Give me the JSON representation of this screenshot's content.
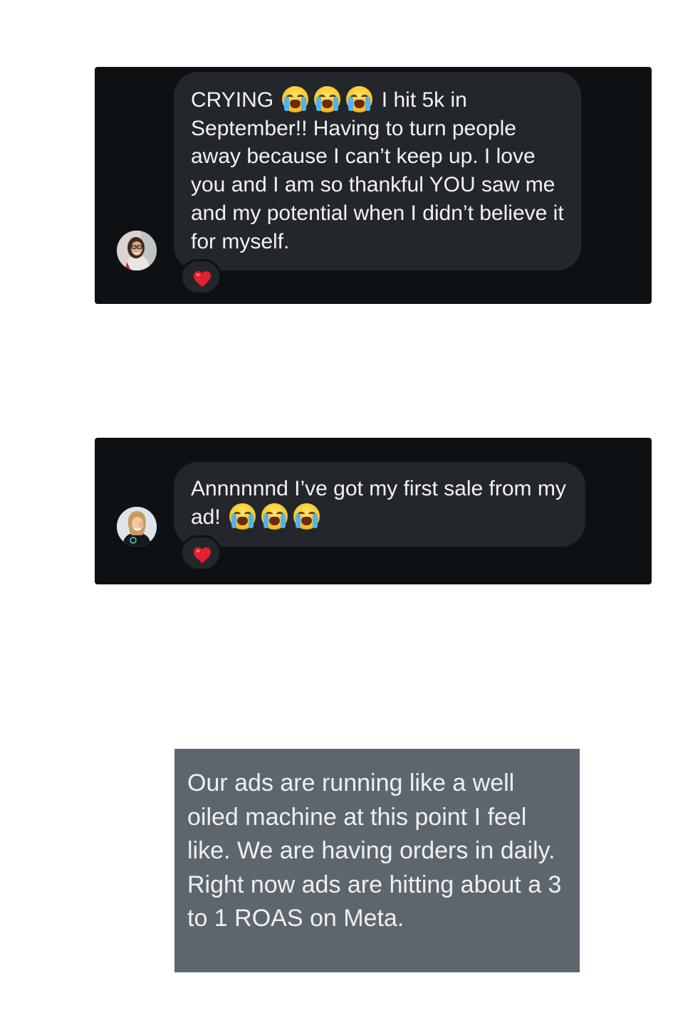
{
  "conversations": [
    {
      "message": {
        "segments": [
          "CRYING ",
          " I hit 5k in September!! Having to turn people away because I can’t keep up. I love you and I am so thankful YOU saw me and my potential when I didn’t believe it for myself."
        ],
        "emoji": [
          "loudly-crying-face",
          "loudly-crying-face",
          "loudly-crying-face"
        ]
      },
      "avatar": "profile-photo",
      "reaction": "red-heart"
    },
    {
      "message": {
        "segments": [
          "Annnnnnd I’ve got my first sale from my ad! "
        ],
        "emoji": [
          "loudly-crying-face",
          "loudly-crying-face",
          "loudly-crying-face"
        ]
      },
      "avatar": "profile-photo",
      "reaction": "red-heart"
    }
  ],
  "note": {
    "text": "Our ads are running like a well oiled machine at this point I feel like. We are having orders in daily. Right now ads are hitting about a 3 to 1 ROAS on Meta."
  },
  "colors": {
    "page_bg": "#ffffff",
    "card_bg": "#0d1114",
    "bubble_bg": "#23262b",
    "bubble_text": "#f2f3f5",
    "note_bg": "#5e666d",
    "note_text": "#eef0f2",
    "heart": "#e3222f"
  }
}
